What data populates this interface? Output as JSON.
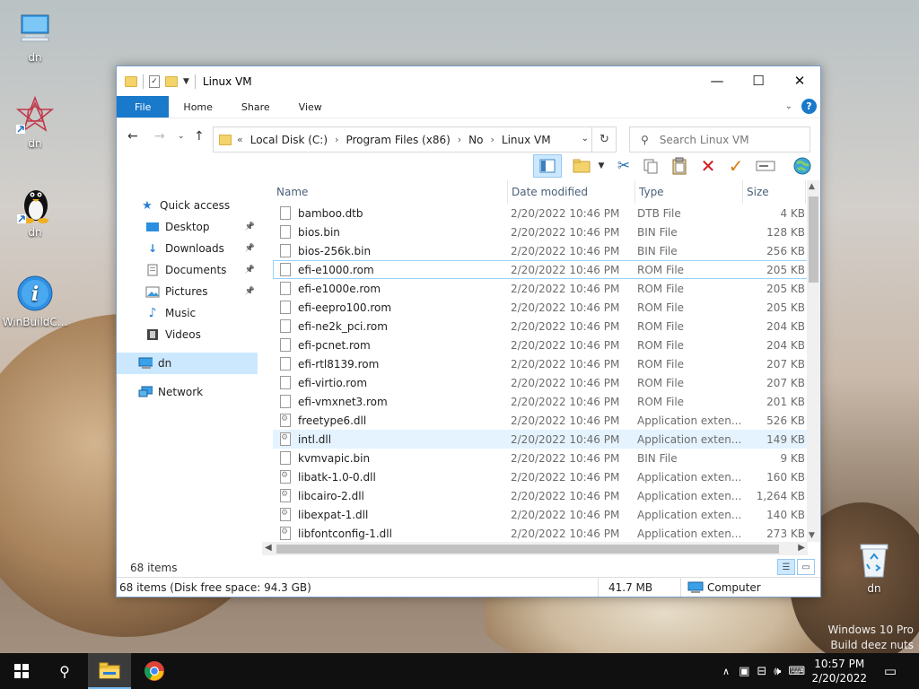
{
  "desktop": {
    "icons": [
      {
        "label": "dn",
        "icon": "this-pc-icon"
      },
      {
        "label": "dn",
        "icon": "app-shortcut-icon"
      },
      {
        "label": "dn",
        "icon": "linux-tux-icon"
      },
      {
        "label": "WinBuildC...",
        "icon": "info-icon"
      }
    ],
    "recycle_bin": {
      "label": "dn"
    },
    "watermark": {
      "line1": "Windows 10 Pro",
      "line2": "Build deez nuts"
    }
  },
  "window": {
    "title": "Linux VM",
    "controls": {
      "minimize": "—",
      "maximize": "☐",
      "close": "✕"
    },
    "ribbon": {
      "tabs": [
        "File",
        "Home",
        "Share",
        "View"
      ],
      "help": "?"
    },
    "address": {
      "overflow": "«",
      "crumbs": [
        "Local Disk (C:)",
        "Program Files (x86)",
        "No",
        "Linux VM"
      ],
      "separator": "›"
    },
    "search": {
      "placeholder": "Search Linux VM"
    },
    "nav_pane": [
      {
        "label": "Quick access",
        "icon": "star-icon",
        "pinned": false,
        "selected": false
      },
      {
        "label": "Desktop",
        "icon": "desktop-folder-icon",
        "pinned": true,
        "selected": false
      },
      {
        "label": "Downloads",
        "icon": "download-arrow-icon",
        "pinned": true,
        "selected": false
      },
      {
        "label": "Documents",
        "icon": "document-icon",
        "pinned": true,
        "selected": false
      },
      {
        "label": "Pictures",
        "icon": "pictures-icon",
        "pinned": true,
        "selected": false
      },
      {
        "label": "Music",
        "icon": "music-note-icon",
        "pinned": false,
        "selected": false
      },
      {
        "label": "Videos",
        "icon": "film-icon",
        "pinned": false,
        "selected": false
      },
      {
        "label": "dn",
        "icon": "computer-icon",
        "pinned": false,
        "selected": true
      },
      {
        "label": "Network",
        "icon": "network-icon",
        "pinned": false,
        "selected": false
      }
    ],
    "columns": {
      "name": "Name",
      "date": "Date modified",
      "type": "Type",
      "size": "Size"
    },
    "files": [
      {
        "name": "bamboo.dtb",
        "date": "2/20/2022 10:46 PM",
        "type": "DTB File",
        "size": "4 KB",
        "kind": "file"
      },
      {
        "name": "bios.bin",
        "date": "2/20/2022 10:46 PM",
        "type": "BIN File",
        "size": "128 KB",
        "kind": "file"
      },
      {
        "name": "bios-256k.bin",
        "date": "2/20/2022 10:46 PM",
        "type": "BIN File",
        "size": "256 KB",
        "kind": "file"
      },
      {
        "name": "efi-e1000.rom",
        "date": "2/20/2022 10:46 PM",
        "type": "ROM File",
        "size": "205 KB",
        "kind": "file"
      },
      {
        "name": "efi-e1000e.rom",
        "date": "2/20/2022 10:46 PM",
        "type": "ROM File",
        "size": "205 KB",
        "kind": "file"
      },
      {
        "name": "efi-eepro100.rom",
        "date": "2/20/2022 10:46 PM",
        "type": "ROM File",
        "size": "205 KB",
        "kind": "file"
      },
      {
        "name": "efi-ne2k_pci.rom",
        "date": "2/20/2022 10:46 PM",
        "type": "ROM File",
        "size": "204 KB",
        "kind": "file"
      },
      {
        "name": "efi-pcnet.rom",
        "date": "2/20/2022 10:46 PM",
        "type": "ROM File",
        "size": "204 KB",
        "kind": "file"
      },
      {
        "name": "efi-rtl8139.rom",
        "date": "2/20/2022 10:46 PM",
        "type": "ROM File",
        "size": "207 KB",
        "kind": "file"
      },
      {
        "name": "efi-virtio.rom",
        "date": "2/20/2022 10:46 PM",
        "type": "ROM File",
        "size": "207 KB",
        "kind": "file"
      },
      {
        "name": "efi-vmxnet3.rom",
        "date": "2/20/2022 10:46 PM",
        "type": "ROM File",
        "size": "201 KB",
        "kind": "file"
      },
      {
        "name": "freetype6.dll",
        "date": "2/20/2022 10:46 PM",
        "type": "Application exten...",
        "size": "526 KB",
        "kind": "dll"
      },
      {
        "name": "intl.dll",
        "date": "2/20/2022 10:46 PM",
        "type": "Application exten...",
        "size": "149 KB",
        "kind": "dll"
      },
      {
        "name": "kvmvapic.bin",
        "date": "2/20/2022 10:46 PM",
        "type": "BIN File",
        "size": "9 KB",
        "kind": "file"
      },
      {
        "name": "libatk-1.0-0.dll",
        "date": "2/20/2022 10:46 PM",
        "type": "Application exten...",
        "size": "160 KB",
        "kind": "dll"
      },
      {
        "name": "libcairo-2.dll",
        "date": "2/20/2022 10:46 PM",
        "type": "Application exten...",
        "size": "1,264 KB",
        "kind": "dll"
      },
      {
        "name": "libexpat-1.dll",
        "date": "2/20/2022 10:46 PM",
        "type": "Application exten...",
        "size": "140 KB",
        "kind": "dll"
      },
      {
        "name": "libfontconfig-1.dll",
        "date": "2/20/2022 10:46 PM",
        "type": "Application exten...",
        "size": "273 KB",
        "kind": "dll"
      }
    ],
    "item_count": "68 items",
    "status": {
      "left": "68 items (Disk free space: 94.3 GB)",
      "size": "41.7 MB",
      "location": "Computer"
    }
  },
  "taskbar": {
    "clock_time": "10:57 PM",
    "clock_date": "2/20/2022"
  },
  "colors": {
    "accent": "#1979ca",
    "selection": "#cce8ff",
    "hover": "#e5f3ff",
    "taskbar": "#101010"
  }
}
